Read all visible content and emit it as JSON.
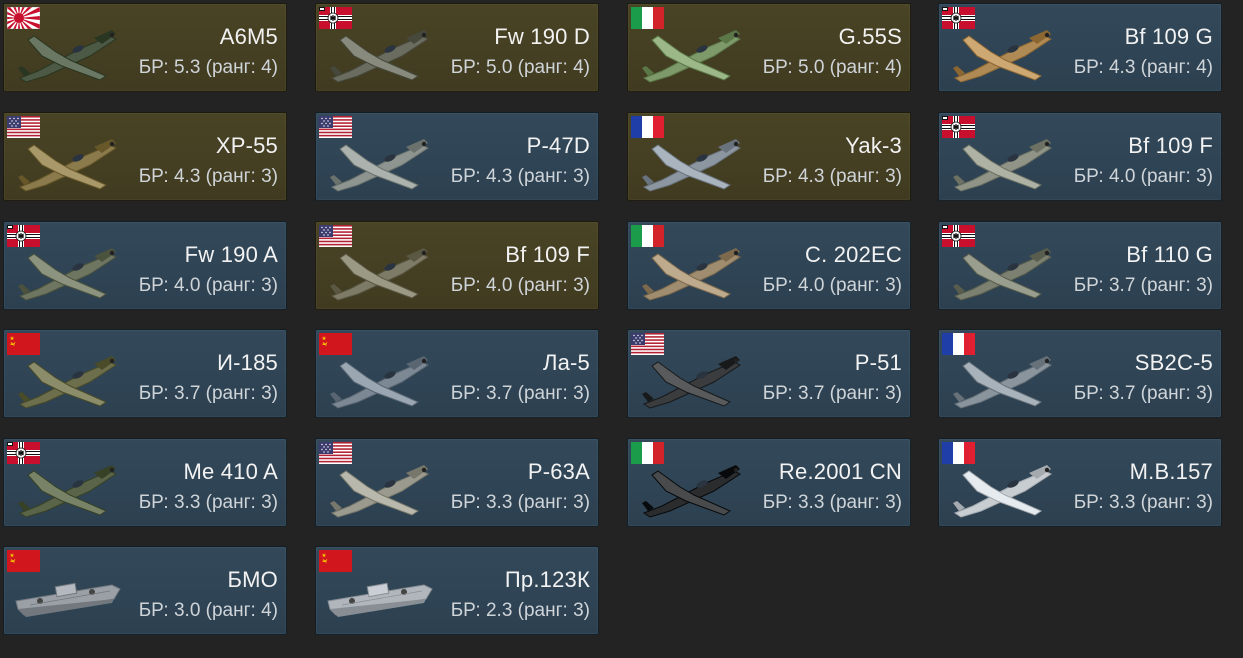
{
  "br_label": "БР:",
  "rank_label": "ранг:",
  "colors": {
    "tier_blue": "#2f4454",
    "tier_gold": "#463f22",
    "background": "#232323",
    "text_primary": "#f2f2f2",
    "text_secondary": "#cfd4d8"
  },
  "vehicles": [
    {
      "name": "A6M5",
      "br": "5.3",
      "rank": "4",
      "flag": "japan",
      "tier": "gold",
      "kind": "plane",
      "paint": "#4c5944"
    },
    {
      "name": "Fw 190 D",
      "br": "5.0",
      "rank": "4",
      "flag": "germany",
      "tier": "gold",
      "kind": "plane",
      "paint": "#6a6c60"
    },
    {
      "name": "G.55S",
      "br": "5.0",
      "rank": "4",
      "flag": "italy",
      "tier": "gold",
      "kind": "plane",
      "paint": "#7e9a6a"
    },
    {
      "name": "Bf 109 G",
      "br": "4.3",
      "rank": "4",
      "flag": "germany",
      "tier": "blue",
      "kind": "plane",
      "paint": "#b08a55"
    },
    {
      "name": "XP-55",
      "br": "4.3",
      "rank": "3",
      "flag": "usa",
      "tier": "gold",
      "kind": "plane",
      "paint": "#8a7a4c"
    },
    {
      "name": "P-47D",
      "br": "4.3",
      "rank": "3",
      "flag": "usa",
      "tier": "blue",
      "kind": "plane",
      "paint": "#8e9590"
    },
    {
      "name": "Yak-3",
      "br": "4.3",
      "rank": "3",
      "flag": "france",
      "tier": "gold",
      "kind": "plane",
      "paint": "#8c96a0"
    },
    {
      "name": "Bf 109 F",
      "br": "4.0",
      "rank": "3",
      "flag": "germany",
      "tier": "blue",
      "kind": "plane",
      "paint": "#8f9486"
    },
    {
      "name": "Fw 190 A",
      "br": "4.0",
      "rank": "3",
      "flag": "germany",
      "tier": "blue",
      "kind": "plane",
      "paint": "#6e7560"
    },
    {
      "name": "Bf 109 F",
      "br": "4.0",
      "rank": "3",
      "flag": "usa",
      "tier": "gold",
      "kind": "plane",
      "paint": "#7d7a66"
    },
    {
      "name": "C. 202EC",
      "br": "4.0",
      "rank": "3",
      "flag": "italy",
      "tier": "blue",
      "kind": "plane",
      "paint": "#a08d70"
    },
    {
      "name": "Bf 110 G",
      "br": "3.7",
      "rank": "3",
      "flag": "germany",
      "tier": "blue",
      "kind": "plane",
      "paint": "#7c8070"
    },
    {
      "name": "И-185",
      "br": "3.7",
      "rank": "3",
      "flag": "ussr",
      "tier": "blue",
      "kind": "plane",
      "paint": "#6c6e4c"
    },
    {
      "name": "Ла-5",
      "br": "3.7",
      "rank": "3",
      "flag": "ussr",
      "tier": "blue",
      "kind": "plane",
      "paint": "#7c8894"
    },
    {
      "name": "P-51",
      "br": "3.7",
      "rank": "3",
      "flag": "usa",
      "tier": "blue",
      "kind": "plane",
      "paint": "#3a3c3e"
    },
    {
      "name": "SB2C-5",
      "br": "3.7",
      "rank": "3",
      "flag": "france",
      "tier": "blue",
      "kind": "plane",
      "paint": "#8a949c"
    },
    {
      "name": "Me 410 A",
      "br": "3.3",
      "rank": "3",
      "flag": "germany",
      "tier": "blue",
      "kind": "plane",
      "paint": "#5a6448"
    },
    {
      "name": "P-63A",
      "br": "3.3",
      "rank": "3",
      "flag": "usa",
      "tier": "blue",
      "kind": "plane",
      "paint": "#9a9a8e"
    },
    {
      "name": "Re.2001 CN",
      "br": "3.3",
      "rank": "3",
      "flag": "italy",
      "tier": "blue",
      "kind": "plane",
      "paint": "#2a2c2e"
    },
    {
      "name": "M.B.157",
      "br": "3.3",
      "rank": "3",
      "flag": "france",
      "tier": "blue",
      "kind": "plane",
      "paint": "#c8cdd2"
    },
    {
      "name": "БМО",
      "br": "3.0",
      "rank": "4",
      "flag": "ussr",
      "tier": "blue",
      "kind": "boat",
      "paint": "#9aa0a6"
    },
    {
      "name": "Пр.123К",
      "br": "2.3",
      "rank": "3",
      "flag": "ussr",
      "tier": "blue",
      "kind": "boat",
      "paint": "#b0b6bc"
    }
  ]
}
